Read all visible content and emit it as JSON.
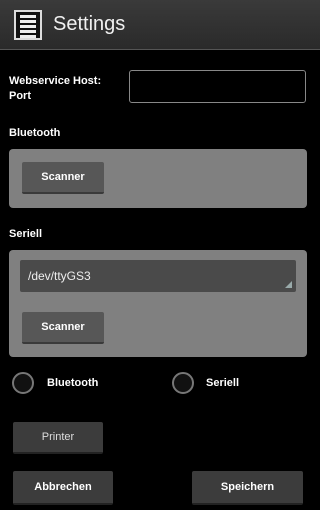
{
  "actionbar": {
    "title": "Settings",
    "icon": "list-menu-icon"
  },
  "webservice": {
    "label": "Webservice Host:\nPort",
    "value": "",
    "placeholder": ""
  },
  "bluetooth": {
    "section_label": "Bluetooth",
    "scanner_label": "Scanner"
  },
  "seriell": {
    "section_label": "Seriell",
    "device_value": "/dev/ttyGS3",
    "scanner_label": "Scanner"
  },
  "connection": {
    "options": [
      "Bluetooth",
      "Seriell"
    ],
    "selected": null
  },
  "actions": {
    "printer_label": "Printer",
    "cancel_label": "Abbrechen",
    "save_label": "Speichern"
  },
  "colors": {
    "background": "#000000",
    "panel": "#808080",
    "button": "#575757"
  }
}
